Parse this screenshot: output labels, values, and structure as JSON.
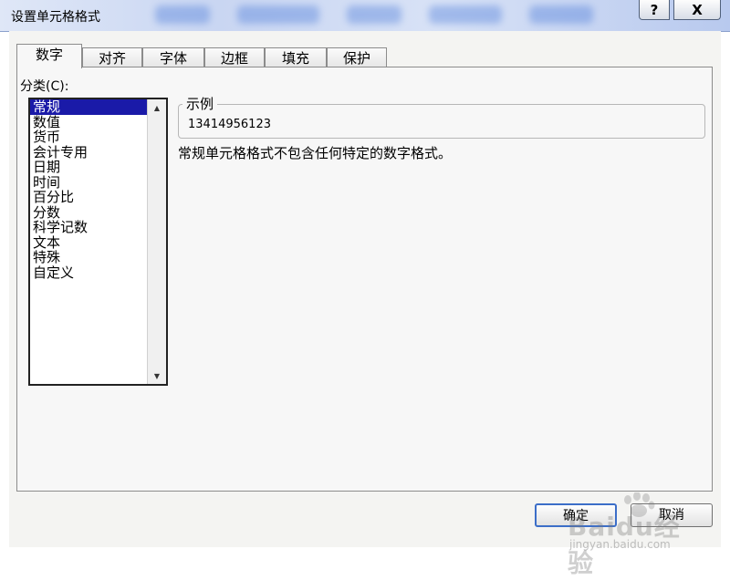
{
  "window": {
    "title": "设置单元格格式",
    "help_label": "?",
    "close_label": "X"
  },
  "tabs": [
    {
      "label": "数字",
      "active": true
    },
    {
      "label": "对齐",
      "active": false
    },
    {
      "label": "字体",
      "active": false
    },
    {
      "label": "边框",
      "active": false
    },
    {
      "label": "填充",
      "active": false
    },
    {
      "label": "保护",
      "active": false
    }
  ],
  "category": {
    "label": "分类(C):",
    "selected_index": 0,
    "items": [
      "常规",
      "数值",
      "货币",
      "会计专用",
      "日期",
      "时间",
      "百分比",
      "分数",
      "科学记数",
      "文本",
      "特殊",
      "自定义"
    ]
  },
  "sample": {
    "legend": "示例",
    "value": "13414956123"
  },
  "description": "常规单元格格式不包含任何特定的数字格式。",
  "buttons": {
    "ok": "确定",
    "cancel": "取消"
  },
  "watermark": {
    "text": "Baidu经验",
    "sub": "jingyan.baidu.com"
  },
  "colors": {
    "selection": "#1a1aa8",
    "ok_border": "#3c6ec8"
  }
}
